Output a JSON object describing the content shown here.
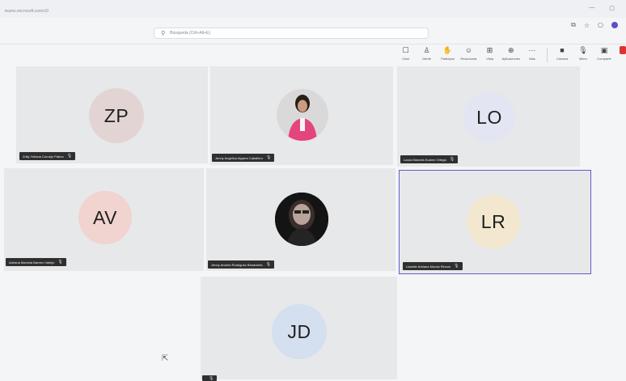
{
  "browser": {
    "url": "teams.microsoft.com/v2/",
    "search_placeholder": "Búsqueda (Ctrl+Alt+E)",
    "window_controls": [
      "—",
      "▢"
    ]
  },
  "toolbar": {
    "items": [
      {
        "label": "Chat",
        "icon": "chat-icon"
      },
      {
        "label": "Gente",
        "icon": "people-icon"
      },
      {
        "label": "Participar",
        "icon": "raise-hand-icon"
      },
      {
        "label": "Reaccionar",
        "icon": "emoji-icon"
      },
      {
        "label": "Vista",
        "icon": "view-icon"
      },
      {
        "label": "Aplicaciones",
        "icon": "apps-icon"
      },
      {
        "label": "Más",
        "icon": "more-icon"
      },
      {
        "label": "Cámara",
        "icon": "camera-icon"
      },
      {
        "label": "Micro",
        "icon": "mic-icon"
      },
      {
        "label": "Compartir",
        "icon": "share-icon"
      }
    ]
  },
  "participants": [
    {
      "name": "Zully Yohana Cornejo Pabon",
      "initials": "ZP",
      "avatar_color": "#e3d4d4"
    },
    {
      "name": "Jenny Angelica Algarra Caballero",
      "initials": "",
      "avatar_color": "#cfcfcf"
    },
    {
      "name": "Laura Marcela Suárez Ortega",
      "initials": "LO",
      "avatar_color": "#e4e5f3"
    },
    {
      "name": "Adriana Marcela Barrero Vallejo",
      "initials": "AV",
      "avatar_color": "#f1d3cf"
    },
    {
      "name": "Jenny Andrea Rodriguez Benavides",
      "initials": "",
      "avatar_color": "#1a1a1a"
    },
    {
      "name": "Lissette Adriana Murcia Rincon",
      "initials": "LR",
      "avatar_color": "#f3e8cf"
    },
    {
      "name": "",
      "initials": "JD",
      "avatar_color": "#d4dff0"
    }
  ],
  "colors": {
    "active_speaker": "#5c5ec8",
    "leave": "#d33333"
  }
}
